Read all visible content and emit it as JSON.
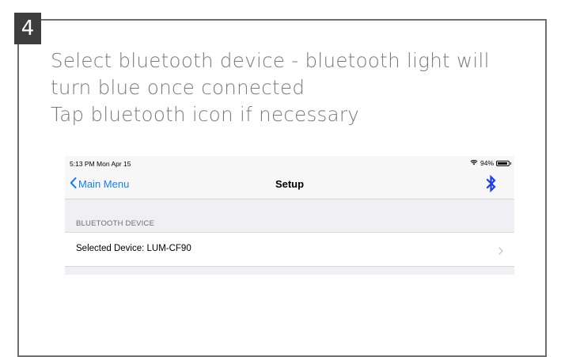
{
  "step": {
    "number": "4"
  },
  "instructions": {
    "line1": "Select bluetooth device - bluetooth light will",
    "line2": "turn blue once connected",
    "line3": "Tap bluetooth icon if necessary"
  },
  "device_screen": {
    "status_bar": {
      "time": "5:13 PM  Mon Apr 15",
      "battery": "94%",
      "battery_level": 0.94,
      "icons": [
        "wifi-icon",
        "battery-icon"
      ]
    },
    "navbar": {
      "back_label": "Main Menu",
      "title": "Setup",
      "icons": [
        "chevron-left-icon",
        "bluetooth-icon"
      ]
    },
    "section": {
      "header": "BLUETOOTH DEVICE",
      "cell_label": "Selected Device: LUM-CF90",
      "icons": [
        "chevron-right-icon"
      ]
    }
  },
  "colors": {
    "ios_blue": "#157efb",
    "bluetooth_blue": "#1a3bf5",
    "badge_bg": "#3d3d3d",
    "instruction_text": "#7a7a7a",
    "frame_border": "#6e6e6e"
  }
}
